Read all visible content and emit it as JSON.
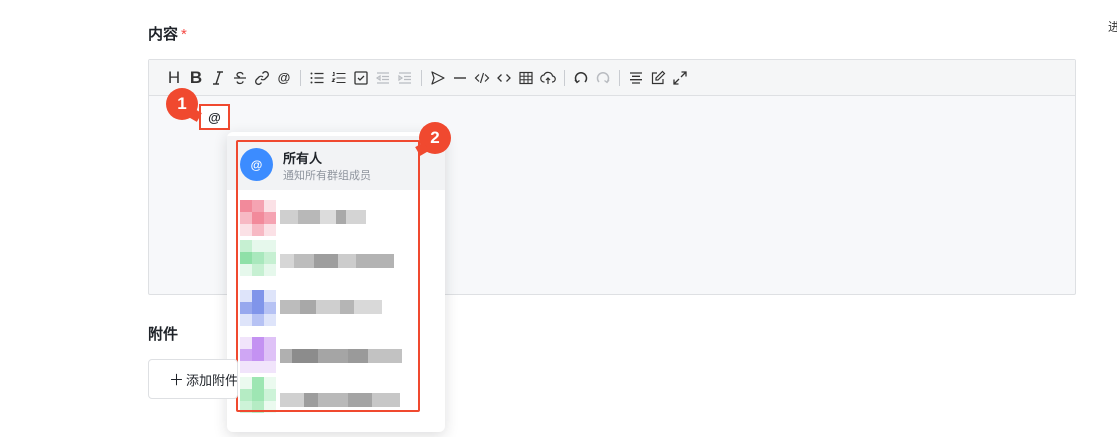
{
  "form": {
    "content_label": "内容",
    "required_mark": "*",
    "attachment_label": "附件",
    "add_attachment_label": "添加附件",
    "edge_text": "进"
  },
  "editor": {
    "typed_text": "@",
    "toolbar": [
      {
        "name": "heading-icon",
        "text": "H"
      },
      {
        "name": "bold-icon",
        "text": "B"
      },
      {
        "name": "italic-icon"
      },
      {
        "name": "strikethrough-icon"
      },
      {
        "name": "link-icon"
      },
      {
        "name": "mention-icon",
        "text": "@"
      },
      {
        "name": "bullet-list-icon"
      },
      {
        "name": "ordered-list-icon"
      },
      {
        "name": "checklist-icon"
      },
      {
        "name": "outdent-icon",
        "disabled": true
      },
      {
        "name": "indent-icon",
        "disabled": true
      },
      {
        "name": "send-icon"
      },
      {
        "name": "horizontal-rule-icon"
      },
      {
        "name": "code-icon"
      },
      {
        "name": "code-block-icon"
      },
      {
        "name": "table-icon"
      },
      {
        "name": "upload-icon"
      },
      {
        "name": "undo-icon"
      },
      {
        "name": "redo-icon",
        "disabled": true
      },
      {
        "name": "align-center-icon"
      },
      {
        "name": "edit-icon"
      },
      {
        "name": "fullscreen-icon"
      }
    ]
  },
  "annotations": {
    "badge1": "1",
    "badge2": "2",
    "color": "#f0492f"
  },
  "mention_dropdown": {
    "all": {
      "avatar_text": "@",
      "name": "所有人",
      "description": "通知所有群组成员",
      "avatar_color": "#3c8cff"
    },
    "members": [
      {
        "avatar_colors": [
          "#f28a9b",
          "#f7b9c4",
          "#fbe1e6",
          "#f5a3b2"
        ]
      },
      {
        "avatar_colors": [
          "#8fe0a8",
          "#c6f0d2",
          "#e6f8ec",
          "#a9e8bd"
        ]
      },
      {
        "avatar_colors": [
          "#8095ea",
          "#b6c2f4",
          "#dee4fa",
          "#97a8ee"
        ]
      },
      {
        "avatar_colors": [
          "#c492f2",
          "#dfc2f7",
          "#f1e4fb",
          "#cfa6f4"
        ]
      },
      {
        "avatar_colors": [
          "#9ee6b3",
          "#cdf3d8",
          "#ebfaef",
          "#b5ecc4"
        ]
      }
    ]
  }
}
